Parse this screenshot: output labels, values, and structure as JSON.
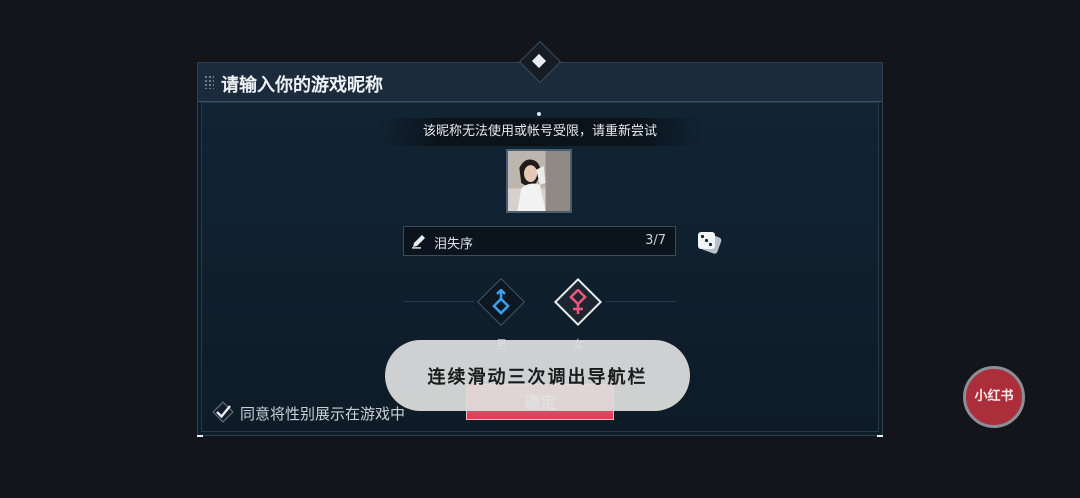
{
  "dialog": {
    "title": "请输入你的游戏昵称",
    "error_message": "该昵称无法使用或帐号受限，请重新尝试"
  },
  "icons": {
    "grip": "grip-dots-icon",
    "top_pin": "pin-icon",
    "pencil": "pencil-icon",
    "dice": "dice-icon",
    "male": "male-symbol-icon",
    "female": "female-symbol-icon",
    "check": "check-icon"
  },
  "name_field": {
    "value": "泪失序",
    "count": "3/7"
  },
  "gender": {
    "male_label": "男",
    "female_label": "女",
    "selected": "女"
  },
  "agree": {
    "label": "同意将性别展示在游戏中",
    "checked": true
  },
  "confirm_label": "确定",
  "toast": "连续滑动三次调出导航栏",
  "badge": "小红书",
  "colors": {
    "accent_pink": "#e43b5c",
    "male_blue": "#3aa0f0",
    "female_pink": "#f0557a",
    "dialog_bg": "#0f1d29"
  }
}
